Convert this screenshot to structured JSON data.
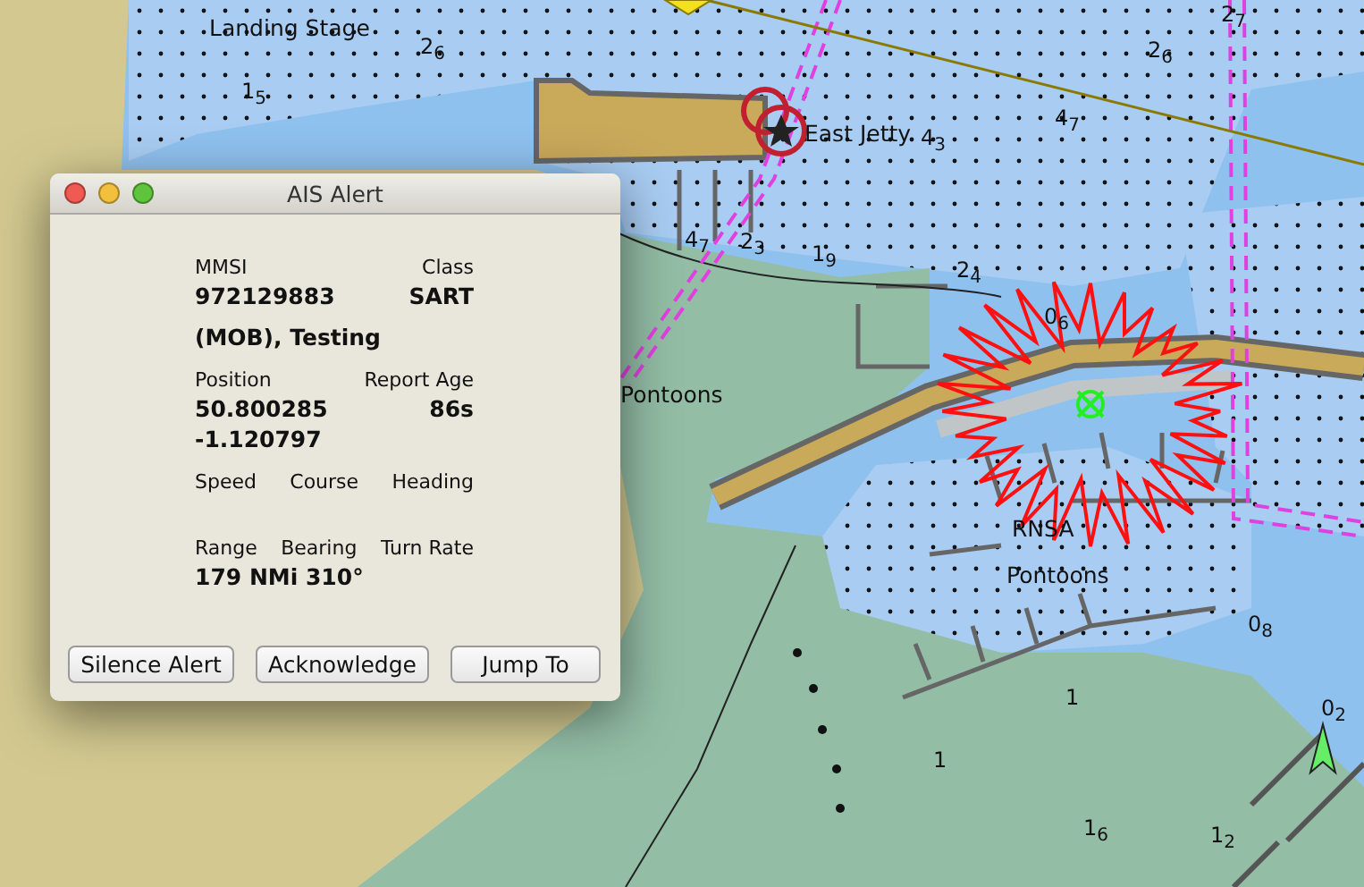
{
  "chart": {
    "labels": [
      {
        "text": "Landing Stage",
        "kind": "place"
      },
      {
        "text": "2$_{6}$",
        "kind": "sounding"
      },
      {
        "text": "1$_{5}$",
        "kind": "sounding"
      },
      {
        "text": "East Jetty",
        "kind": "place"
      },
      {
        "text": "4$_{3}$",
        "kind": "sounding"
      },
      {
        "text": "2$_{7}$",
        "kind": "sounding"
      },
      {
        "text": "2$_{6}$",
        "kind": "sounding"
      },
      {
        "text": "4$_{7}$",
        "kind": "sounding"
      },
      {
        "text": "4$_{7}$",
        "kind": "sounding"
      },
      {
        "text": "2$_{3}$",
        "kind": "sounding"
      },
      {
        "text": "1$_{9}$",
        "kind": "sounding"
      },
      {
        "text": "2$_{4}$",
        "kind": "sounding"
      },
      {
        "text": "0$_{6}$",
        "kind": "sounding"
      },
      {
        "text": "Pontoons",
        "kind": "place"
      },
      {
        "text": "RNSA",
        "kind": "place"
      },
      {
        "text": "Pontoons",
        "kind": "place"
      },
      {
        "text": "0$_{8}$",
        "kind": "sounding"
      },
      {
        "text": "0$_{2}$",
        "kind": "sounding"
      },
      {
        "text": "1",
        "kind": "sounding"
      },
      {
        "text": "1",
        "kind": "sounding"
      },
      {
        "text": "1$_{6}$",
        "kind": "sounding"
      },
      {
        "text": "1$_{2}$",
        "kind": "sounding"
      }
    ]
  },
  "dialog": {
    "title": "AIS Alert",
    "rows": [
      {
        "kind": "label",
        "items": [
          "MMSI",
          "Class"
        ]
      },
      {
        "kind": "value",
        "items": [
          "972129883",
          "SART"
        ]
      },
      {
        "kind": "value",
        "items": [
          "(MOB), Testing"
        ]
      },
      {
        "kind": "label",
        "items": [
          "Position",
          "Report Age"
        ]
      },
      {
        "kind": "value",
        "items": [
          "50.800285",
          "86s"
        ]
      },
      {
        "kind": "value",
        "items": [
          "-1.120797"
        ]
      },
      {
        "kind": "label",
        "items": [
          "Speed",
          "Course",
          "Heading"
        ]
      },
      {
        "kind": "label",
        "items": [
          "Range",
          "Bearing",
          "Turn Rate"
        ]
      },
      {
        "kind": "value",
        "items": [
          "179 NMi 310°"
        ]
      }
    ],
    "buttons": [
      "Silence Alert",
      "Acknowledge",
      "Jump To"
    ]
  }
}
